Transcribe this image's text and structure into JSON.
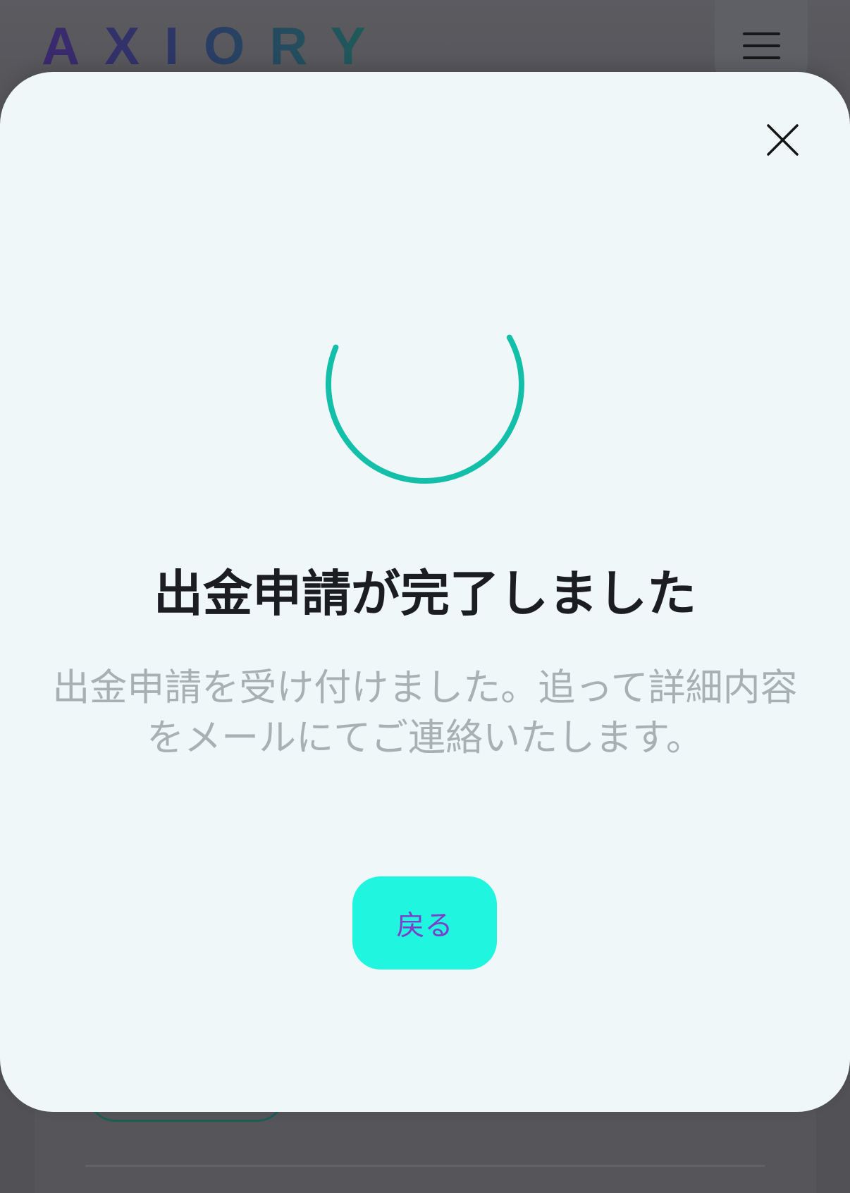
{
  "header": {
    "logo_text": "AXIORY",
    "menu_icon": "hamburger-icon"
  },
  "modal": {
    "close_icon": "close-icon",
    "status_icon": "progress-ring-icon",
    "title": "出金申請が完了しました",
    "message": "出金申請を受け付けました。追って詳細内容をメールにてご連絡いたします。",
    "back_button_label": "戻る"
  },
  "colors": {
    "overlay_background": "#59595e",
    "modal_background": "#eff7f8",
    "ring_accent": "#13bfa8",
    "button_background": "#1ff5df",
    "button_text": "#7b3fc9",
    "title_text": "#1c1c23",
    "message_text": "#a7b1b3",
    "logo_gradient_start": "#3c286f",
    "logo_gradient_end": "#1d5f58"
  }
}
